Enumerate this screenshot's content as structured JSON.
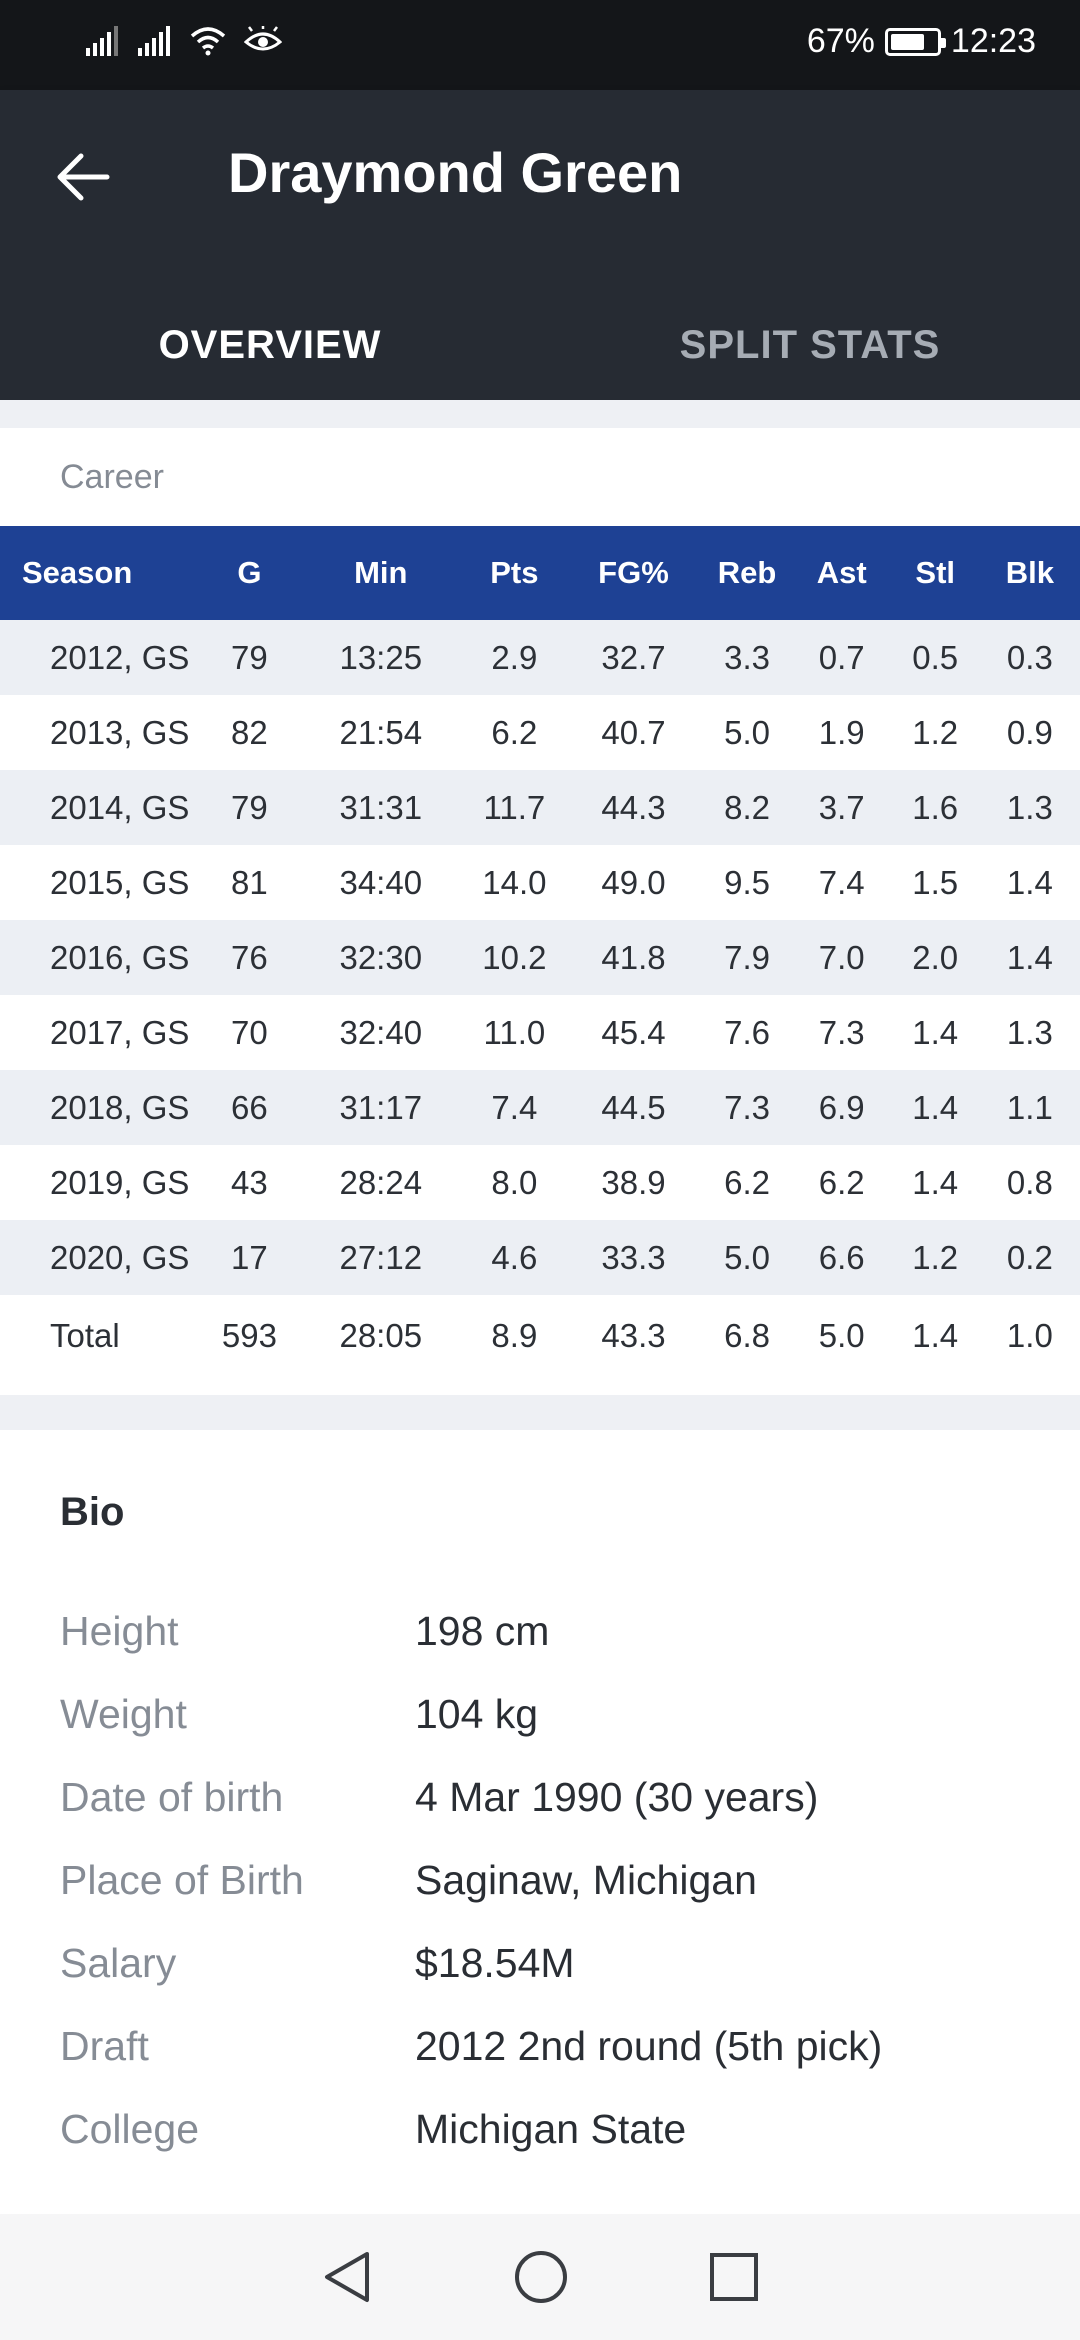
{
  "status_bar": {
    "battery_percent": "67%",
    "battery_level": 0.67,
    "time": "12:23"
  },
  "app_bar": {
    "title": "Draymond Green",
    "tabs": [
      {
        "label": "OVERVIEW",
        "active": true
      },
      {
        "label": "SPLIT STATS",
        "active": false
      }
    ]
  },
  "career": {
    "label": "Career",
    "columns": [
      "Season",
      "G",
      "Min",
      "Pts",
      "FG%",
      "Reb",
      "Ast",
      "Stl",
      "Blk"
    ],
    "rows": [
      [
        "2012, GS",
        "79",
        "13:25",
        "2.9",
        "32.7",
        "3.3",
        "0.7",
        "0.5",
        "0.3"
      ],
      [
        "2013, GS",
        "82",
        "21:54",
        "6.2",
        "40.7",
        "5.0",
        "1.9",
        "1.2",
        "0.9"
      ],
      [
        "2014, GS",
        "79",
        "31:31",
        "11.7",
        "44.3",
        "8.2",
        "3.7",
        "1.6",
        "1.3"
      ],
      [
        "2015, GS",
        "81",
        "34:40",
        "14.0",
        "49.0",
        "9.5",
        "7.4",
        "1.5",
        "1.4"
      ],
      [
        "2016, GS",
        "76",
        "32:30",
        "10.2",
        "41.8",
        "7.9",
        "7.0",
        "2.0",
        "1.4"
      ],
      [
        "2017, GS",
        "70",
        "32:40",
        "11.0",
        "45.4",
        "7.6",
        "7.3",
        "1.4",
        "1.3"
      ],
      [
        "2018, GS",
        "66",
        "31:17",
        "7.4",
        "44.5",
        "7.3",
        "6.9",
        "1.4",
        "1.1"
      ],
      [
        "2019, GS",
        "43",
        "28:24",
        "8.0",
        "38.9",
        "6.2",
        "6.2",
        "1.4",
        "0.8"
      ],
      [
        "2020, GS",
        "17",
        "27:12",
        "4.6",
        "33.3",
        "5.0",
        "6.6",
        "1.2",
        "0.2"
      ],
      [
        "Total",
        "593",
        "28:05",
        "8.9",
        "43.3",
        "6.8",
        "5.0",
        "1.4",
        "1.0"
      ]
    ]
  },
  "bio": {
    "heading": "Bio",
    "items": [
      {
        "label": "Height",
        "value": "198 cm"
      },
      {
        "label": "Weight",
        "value": "104 kg"
      },
      {
        "label": "Date of birth",
        "value": "4 Mar 1990 (30 years)"
      },
      {
        "label": "Place of Birth",
        "value": "Saginaw, Michigan"
      },
      {
        "label": "Salary",
        "value": "$18.54M"
      },
      {
        "label": "Draft",
        "value": "2012 2nd round (5th pick)"
      },
      {
        "label": "College",
        "value": "Michigan State"
      }
    ]
  },
  "colors": {
    "status_bar_bg": "#141619",
    "app_bar_bg": "#262b33",
    "table_header_bg": "#1e4194",
    "row_alt_bg": "#eceff4"
  },
  "icons": [
    "signal-icon",
    "wifi-icon",
    "eye-icon",
    "battery-icon",
    "back-arrow-icon",
    "nav-back-icon",
    "nav-home-icon",
    "nav-recents-icon"
  ]
}
